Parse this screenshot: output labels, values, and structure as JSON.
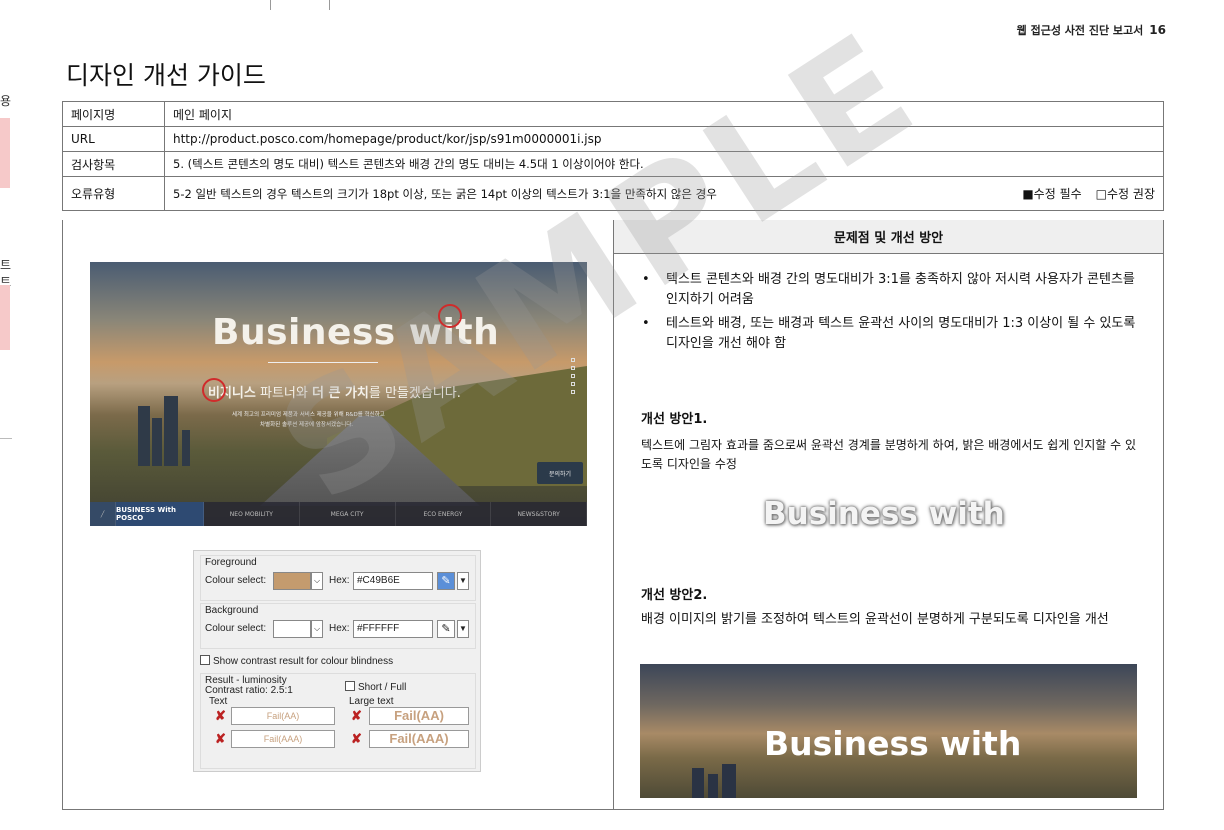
{
  "left_page": {
    "fragment_1": "용",
    "fragment_2": "트트"
  },
  "header": {
    "report_title": "웹 접근성 사전 진단 보고서",
    "page_number": "16"
  },
  "title": "디자인 개선 가이드",
  "info": {
    "rows": [
      {
        "label": "페이지명",
        "value": "메인 페이지"
      },
      {
        "label": "URL",
        "value": "http://product.posco.com/homepage/product/kor/jsp/s91m0000001i.jsp"
      },
      {
        "label": "검사항목",
        "value": "5. (텍스트 콘텐츠의 명도 대비) 텍스트 콘텐츠와 배경 간의 명도 대비는 4.5대 1 이상이어야 한다."
      },
      {
        "label": "오류유형",
        "value": "5-2 일반 텍스트의 경우 텍스트의 크기가 18pt 이상, 또는 굵은 14pt 이상의 텍스트가 3:1을 만족하지 않은 경우"
      }
    ],
    "check_required": "■수정 필수",
    "check_recommended": "□수정 권장"
  },
  "right_header": "문제점 및 개선 방안",
  "hero": {
    "headline": "Business with",
    "subline_pre": "비",
    "subline_bold1": "지니스",
    "subline_mid": " 파트너와 ",
    "subline_bold2": "더 큰 가치",
    "subline_post": "를 만들겠습니다.",
    "small_line1": "세계 최고의 프리미엄 제품과 서비스 제공을 위해 R&D를 혁신하고",
    "small_line2": "차별화된 솔루션 제공에 앞장서겠습니다.",
    "consult": "문의하기",
    "nav": [
      "BUSINESS With POSCO",
      "NEO MOBILITY",
      "MEGA CITY",
      "ECO ENERGY",
      "NEWS&STORY"
    ]
  },
  "tool": {
    "foreground_label": "Foreground",
    "colour_select": "Colour select:",
    "hex_label": "Hex:",
    "fg_hex": "#C49B6E",
    "fg_color": "#C49B6E",
    "background_label": "Background",
    "bg_hex": "#FFFFFF",
    "bg_color": "#FFFFFF",
    "blindness_label": "Show contrast result for colour blindness",
    "result_label": "Result - luminosity",
    "contrast_ratio": "Contrast ratio: 2.5:1",
    "short_full": "Short / Full",
    "text_label": "Text",
    "large_text_label": "Large text",
    "fail_aa": "Fail(AA)",
    "fail_aaa": "Fail(AAA)"
  },
  "right": {
    "bullets": [
      "텍스트 콘텐츠와 배경 간의 명도대비가 3:1를 충족하지 않아 저시력 사용자가 콘텐츠를 인지하기 어려움",
      "테스트와 배경, 또는 배경과 텍스트 윤곽선 사이의 명도대비가 1:3 이상이 될 수 있도록 디자인을 개선 해야 함"
    ],
    "plan1_title": "개선 방안1.",
    "plan1_body": "텍스트에 그림자 효과를 줌으로써 윤곽선 경계를 분명하게 하여, 밝은 배경에서도 쉽게 인지할 수 있도록 디자인을 수정",
    "plan1_sample": "Business with",
    "plan2_title": "개선 방안2.",
    "plan2_body": "배경 이미지의 밝기를 조정하여 텍스트의 윤곽선이 분명하게 구분되도록 디자인을 개선",
    "plan2_sample": "Business with"
  },
  "watermark": "SAMPLE"
}
